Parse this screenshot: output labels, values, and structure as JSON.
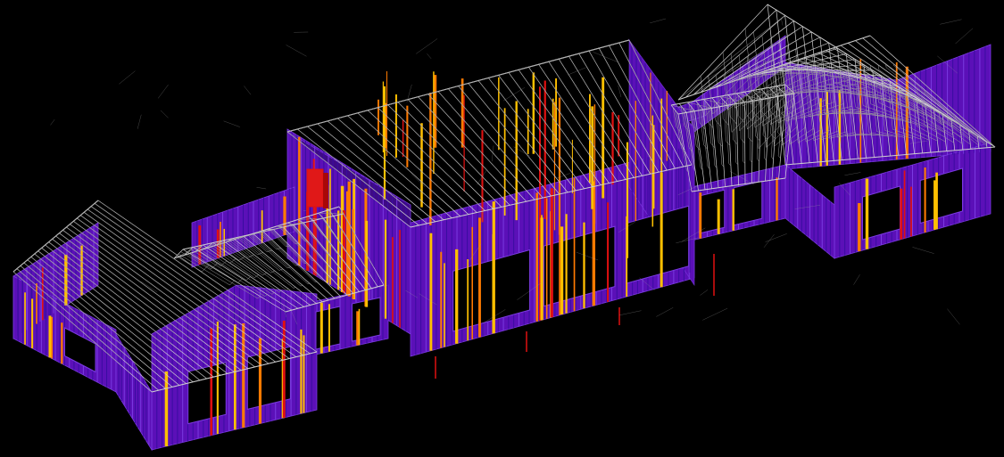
{
  "viewport": {
    "background": "#000000"
  },
  "colors": {
    "wall_fill": "#5b10b8",
    "wall_fill_dark": "#3e0a86",
    "stud": "#3a0ca0",
    "stud_light": "#7a3ae0",
    "truss": "#cfcfcf",
    "truss_dim": "#9a9a9a",
    "member_yellow": "#ffc000",
    "member_orange": "#ff7a00",
    "member_red": "#e01010",
    "opening": "#000000"
  },
  "model": {
    "description_icon": "timber-frame-wireframe",
    "wings": [
      "left-wing",
      "left-link",
      "central-block",
      "right-link",
      "right-wing"
    ]
  }
}
